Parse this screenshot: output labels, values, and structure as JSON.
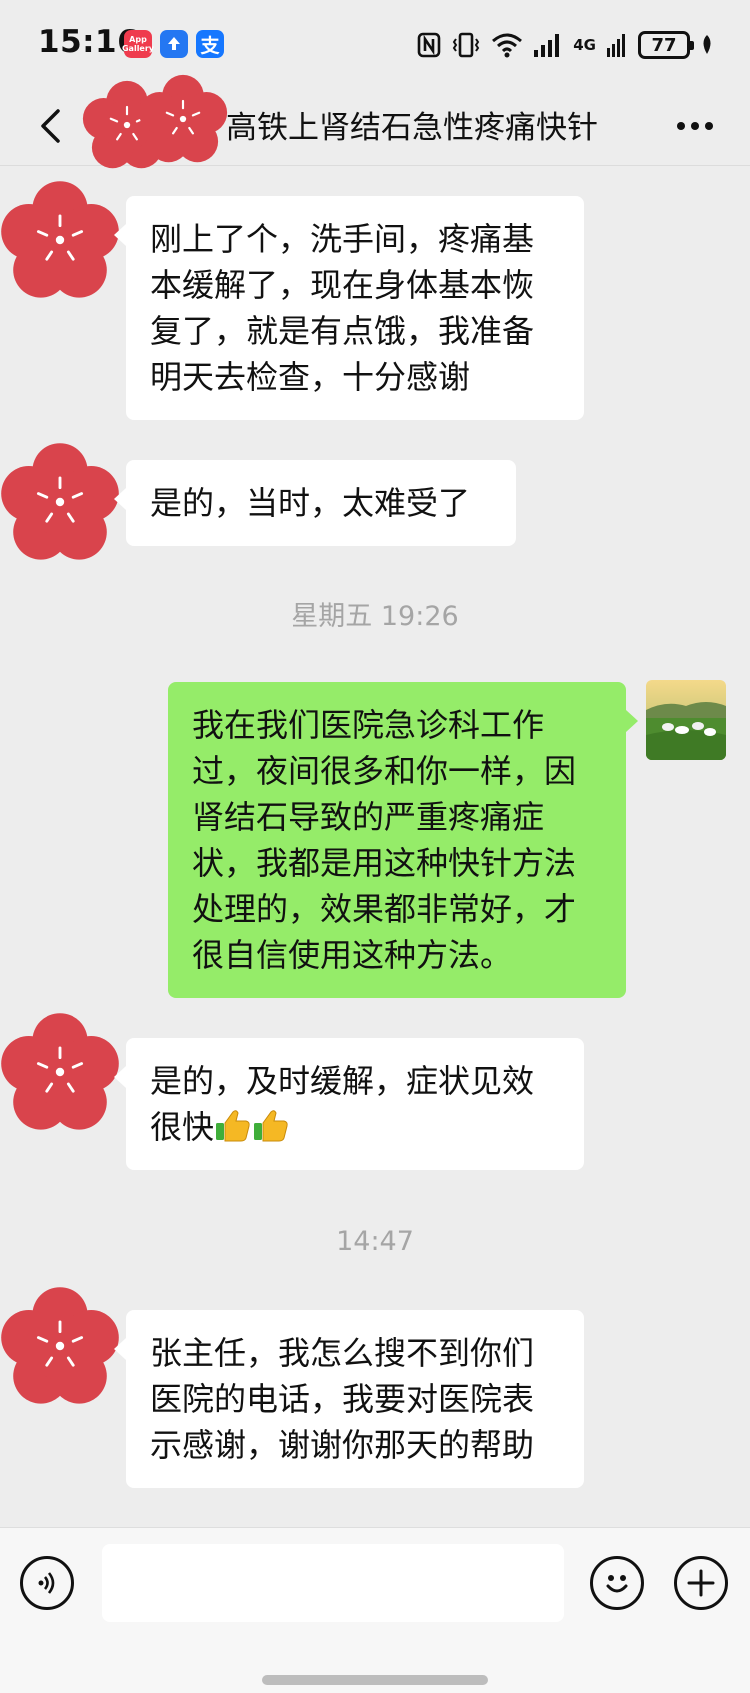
{
  "status_bar": {
    "time": "15:16",
    "battery": "77",
    "network": "4G",
    "apps": [
      "App Gallery",
      "upload",
      "支"
    ]
  },
  "header": {
    "title": "高铁上肾结石急性疼痛快针"
  },
  "messages": [
    {
      "side": "left",
      "text": "刚上了个，洗手间，疼痛基本缓解了，现在身体基本恢复了，就是有点饿，我准备明天去检查，十分感谢"
    },
    {
      "side": "left",
      "text": "是的，当时，太难受了"
    },
    {
      "timestamp": "星期五 19:26"
    },
    {
      "side": "right",
      "text": "我在我们医院急诊科工作过，夜间很多和你一样，因肾结石导致的严重疼痛症状，我都是用这种快针方法处理的，效果都非常好，才很自信使用这种方法。"
    },
    {
      "side": "left",
      "text": "是的，及时缓解，症状见效很快"
    },
    {
      "timestamp": "14:47"
    },
    {
      "side": "left",
      "text": "张主任，我怎么搜不到你们医院的电话，我要对医院表示感谢，谢谢你那天的帮助"
    }
  ],
  "colors": {
    "background": "#ededed",
    "left_bubble": "#ffffff",
    "right_bubble": "#95ec69",
    "timestamp": "#a5a5a5",
    "avatar_sticker": "#d9444c"
  },
  "icons": {
    "back": "chevron-left-icon",
    "more": "more-dots-icon",
    "voice": "voice-icon",
    "emoji": "emoji-icon",
    "plus": "plus-icon",
    "thumbs_up": "thumbs-up-emoji"
  }
}
